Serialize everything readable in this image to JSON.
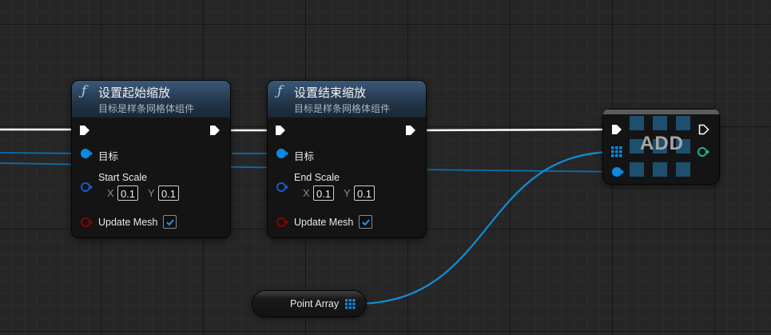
{
  "nodes": {
    "set_start_scale": {
      "title": "设置起始缩放",
      "subtitle": "目标是样条网格体组件",
      "target_label": "目标",
      "scale_label": "Start Scale",
      "x_axis": "X",
      "x_value": "0.1",
      "y_axis": "Y",
      "y_value": "0.1",
      "update_mesh_label": "Update Mesh",
      "update_mesh_checked": true
    },
    "set_end_scale": {
      "title": "设置结束缩放",
      "subtitle": "目标是样条网格体组件",
      "target_label": "目标",
      "scale_label": "End Scale",
      "x_axis": "X",
      "x_value": "0.1",
      "y_axis": "Y",
      "y_value": "0.1",
      "update_mesh_label": "Update Mesh",
      "update_mesh_checked": true
    },
    "add": {
      "label": "ADD"
    },
    "point_array": {
      "label": "Point Array"
    }
  },
  "icons": {
    "function": "function-icon",
    "exec_pin": "exec-pin-icon",
    "object_pin": "object-pin-icon",
    "array_pin": "array-grid-icon",
    "check": "check-icon"
  },
  "colors": {
    "background": "#262626",
    "exec_wire": "#ffffff",
    "object_wire": "#0c8fd8",
    "object_pin": "#0a8be0",
    "vector2d_pin": "#1e57c8",
    "bool_pin": "#8b0000",
    "int_pin": "#1fb48a",
    "function_header": "#3b5878"
  }
}
